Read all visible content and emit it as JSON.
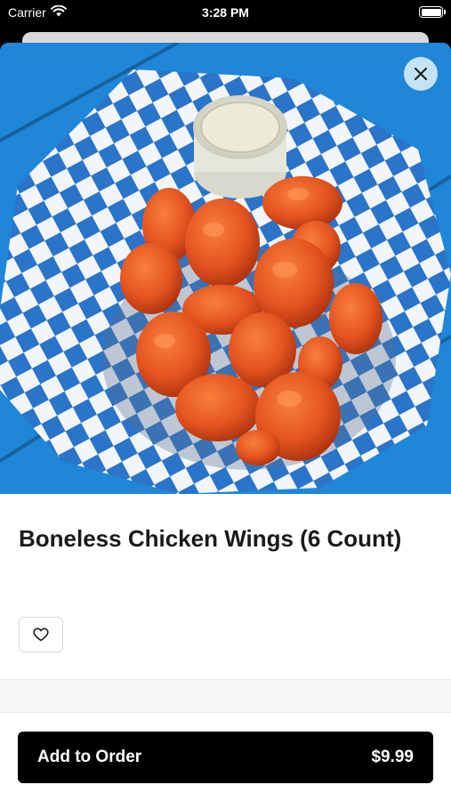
{
  "status_bar": {
    "carrier": "Carrier",
    "time": "3:28 PM",
    "icons": [
      "wifi-icon",
      "battery-icon"
    ]
  },
  "item": {
    "image_alt": "Boneless chicken wings in a checkered paper-lined basket with a cup of dipping sauce",
    "title": "Boneless Chicken Wings (6 Count)"
  },
  "actions": {
    "close_icon": "close-icon",
    "favorite_icon": "heart-icon",
    "add_to_order_label": "Add to Order",
    "price": "$9.99"
  },
  "colors": {
    "accent": "#000000",
    "table_blue": "#1f86d8",
    "sauce_orange": "#e4531f",
    "close_bg": "#d2ebfa"
  }
}
